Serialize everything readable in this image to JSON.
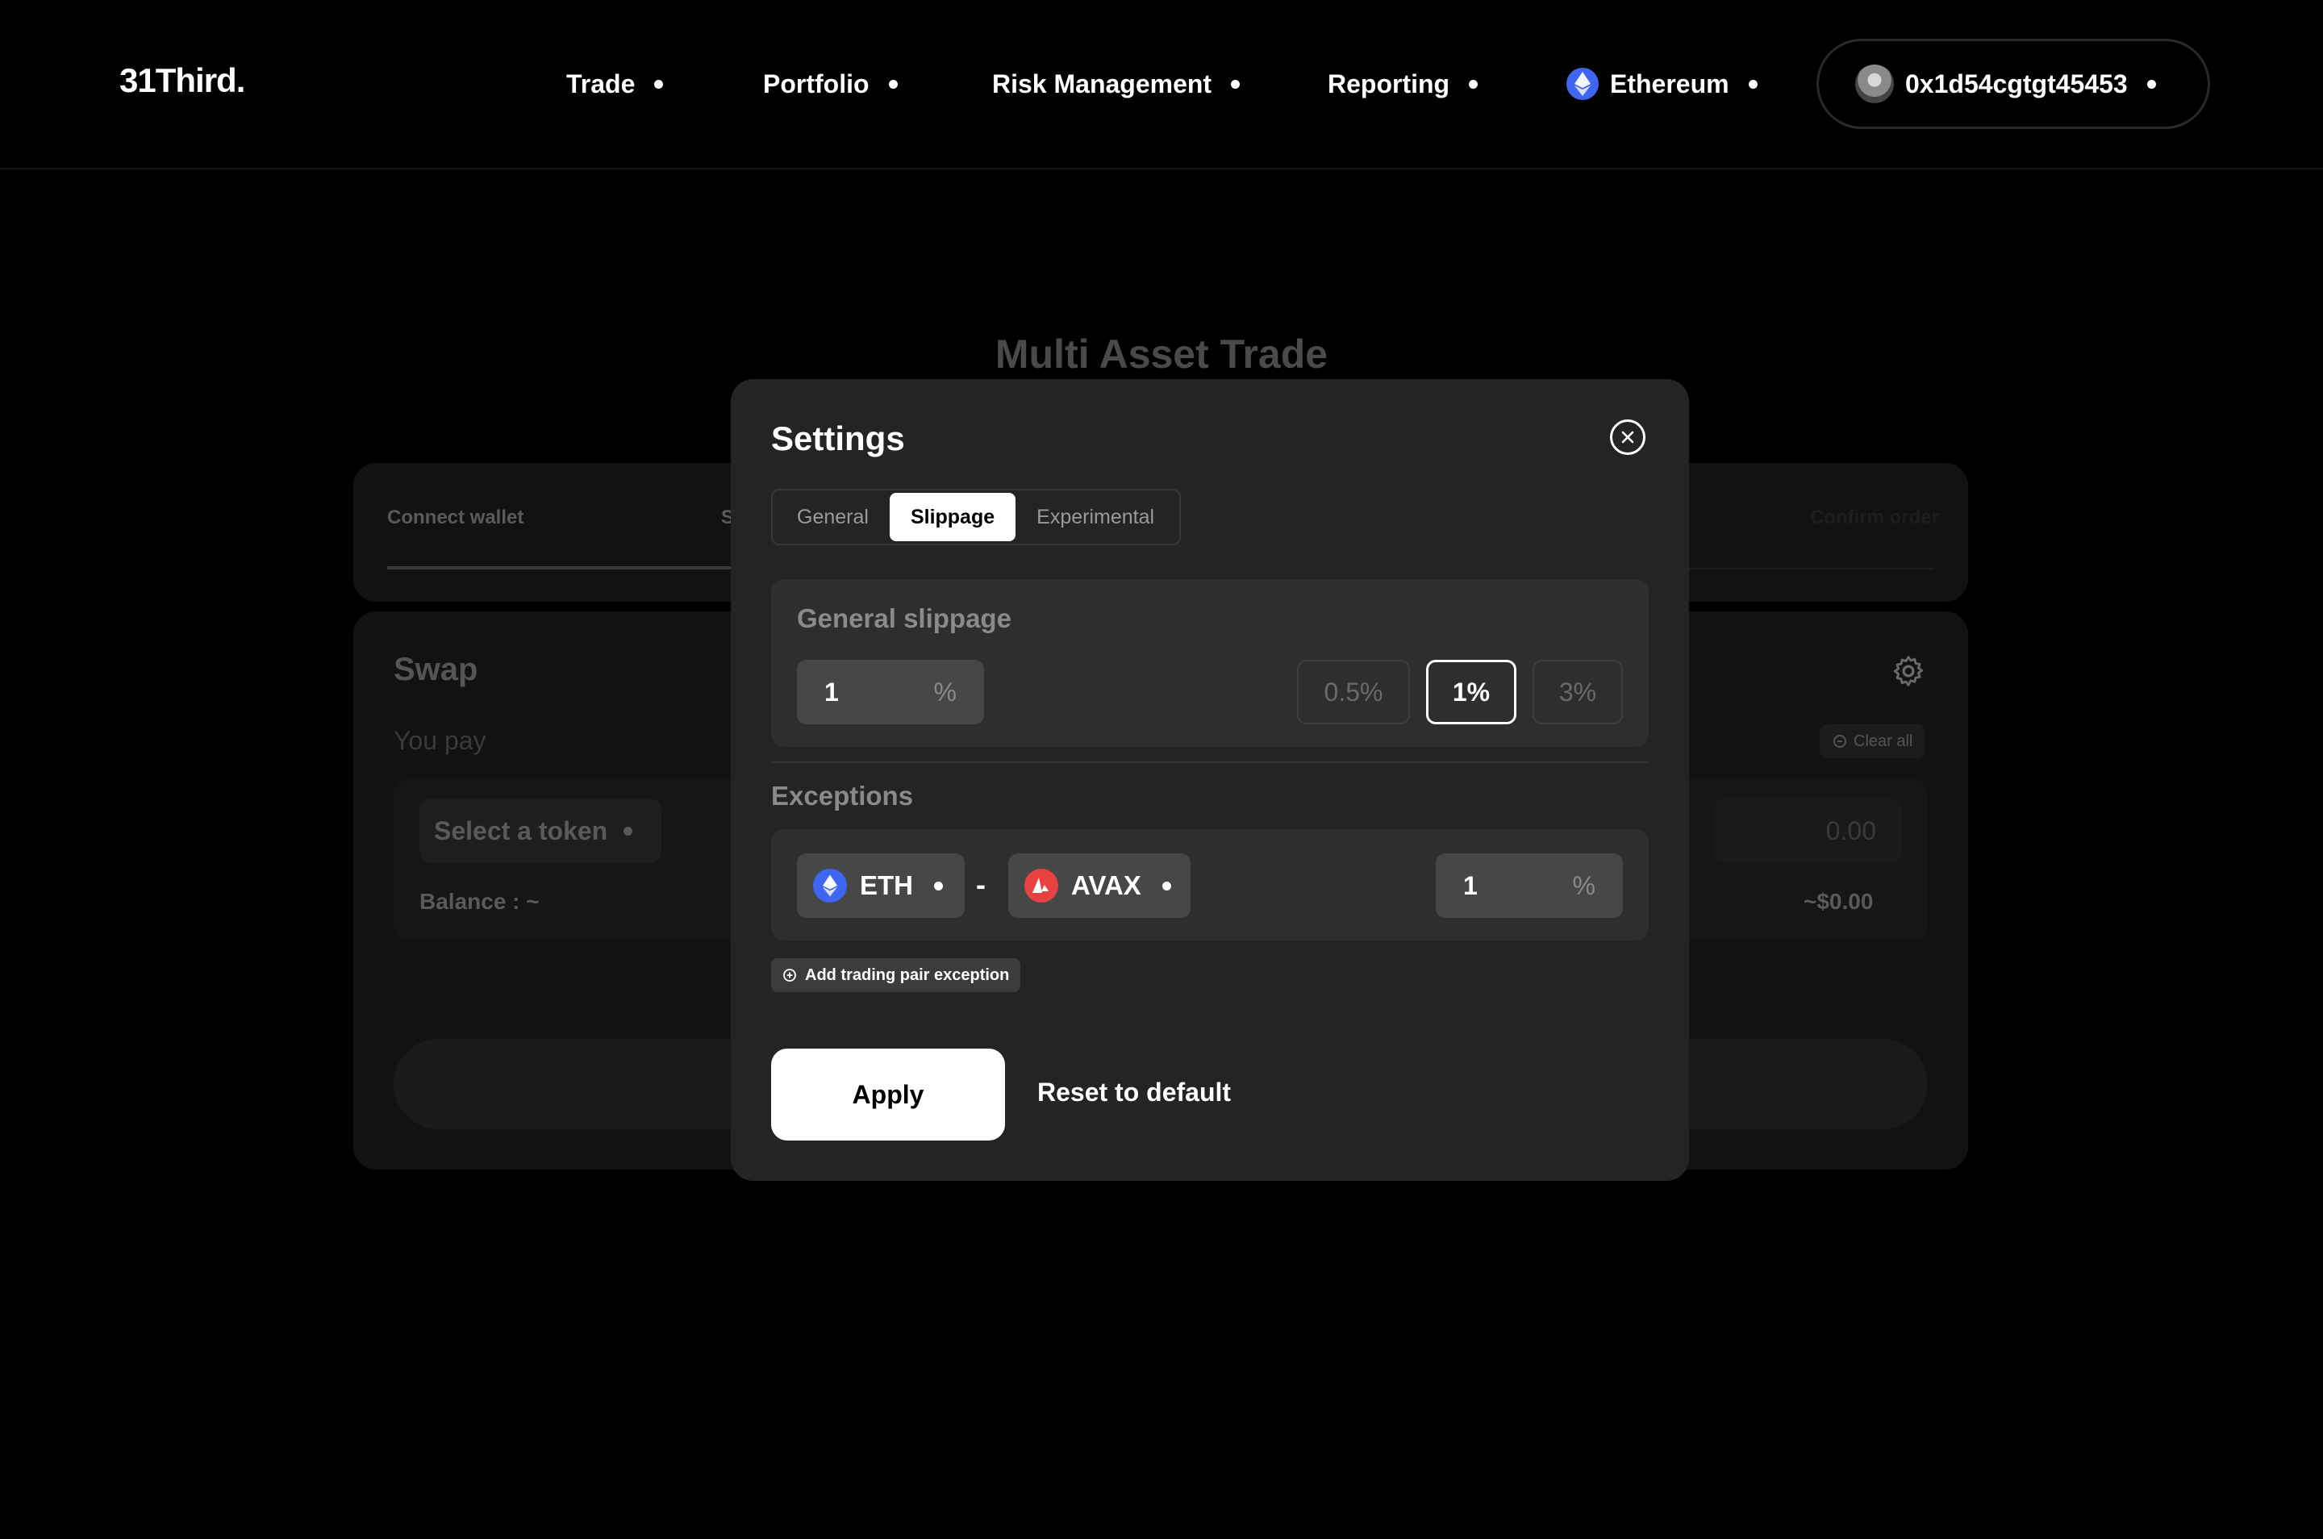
{
  "nav": {
    "logo": "31Third.",
    "items": [
      {
        "label": "Trade"
      },
      {
        "label": "Portfolio"
      },
      {
        "label": "Risk Management"
      },
      {
        "label": "Reporting"
      }
    ],
    "network": {
      "label": "Ethereum",
      "icon": "ethereum-icon"
    },
    "wallet": {
      "address": "0x1d54cgtgt45453",
      "icon": "avatar"
    }
  },
  "background": {
    "title": "Multi Asset Trade",
    "steps": {
      "first": "Connect wallet",
      "second_partial": "S",
      "last": "Confirm order"
    },
    "swap": {
      "title": "Swap",
      "you_pay": "You pay",
      "clear_all": "Clear all",
      "select_token": "Select a token",
      "amount_placeholder": "0.00",
      "balance": "Balance : ~",
      "usd_value": "~$0.00"
    }
  },
  "modal": {
    "title": "Settings",
    "tabs": [
      {
        "label": "General",
        "active": false
      },
      {
        "label": "Slippage",
        "active": true
      },
      {
        "label": "Experimental",
        "active": false
      }
    ],
    "general_slippage": {
      "label": "General slippage",
      "value": "1",
      "unit": "%",
      "presets": [
        {
          "label": "0.5%",
          "active": false
        },
        {
          "label": "1%",
          "active": true
        },
        {
          "label": "3%",
          "active": false
        }
      ]
    },
    "exceptions": {
      "label": "Exceptions",
      "pairs": [
        {
          "from": "ETH",
          "from_icon": "ethereum-icon",
          "separator": "-",
          "to": "AVAX",
          "to_icon": "avalanche-icon",
          "value": "1",
          "unit": "%"
        }
      ],
      "add_label": "Add trading pair exception"
    },
    "apply_label": "Apply",
    "reset_label": "Reset to default"
  },
  "colors": {
    "background": "#000000",
    "modal": "#242424",
    "panel": "#2e2e2e",
    "input": "#474747",
    "ethereum": "#3e66f0",
    "avalanche": "#e84142"
  }
}
